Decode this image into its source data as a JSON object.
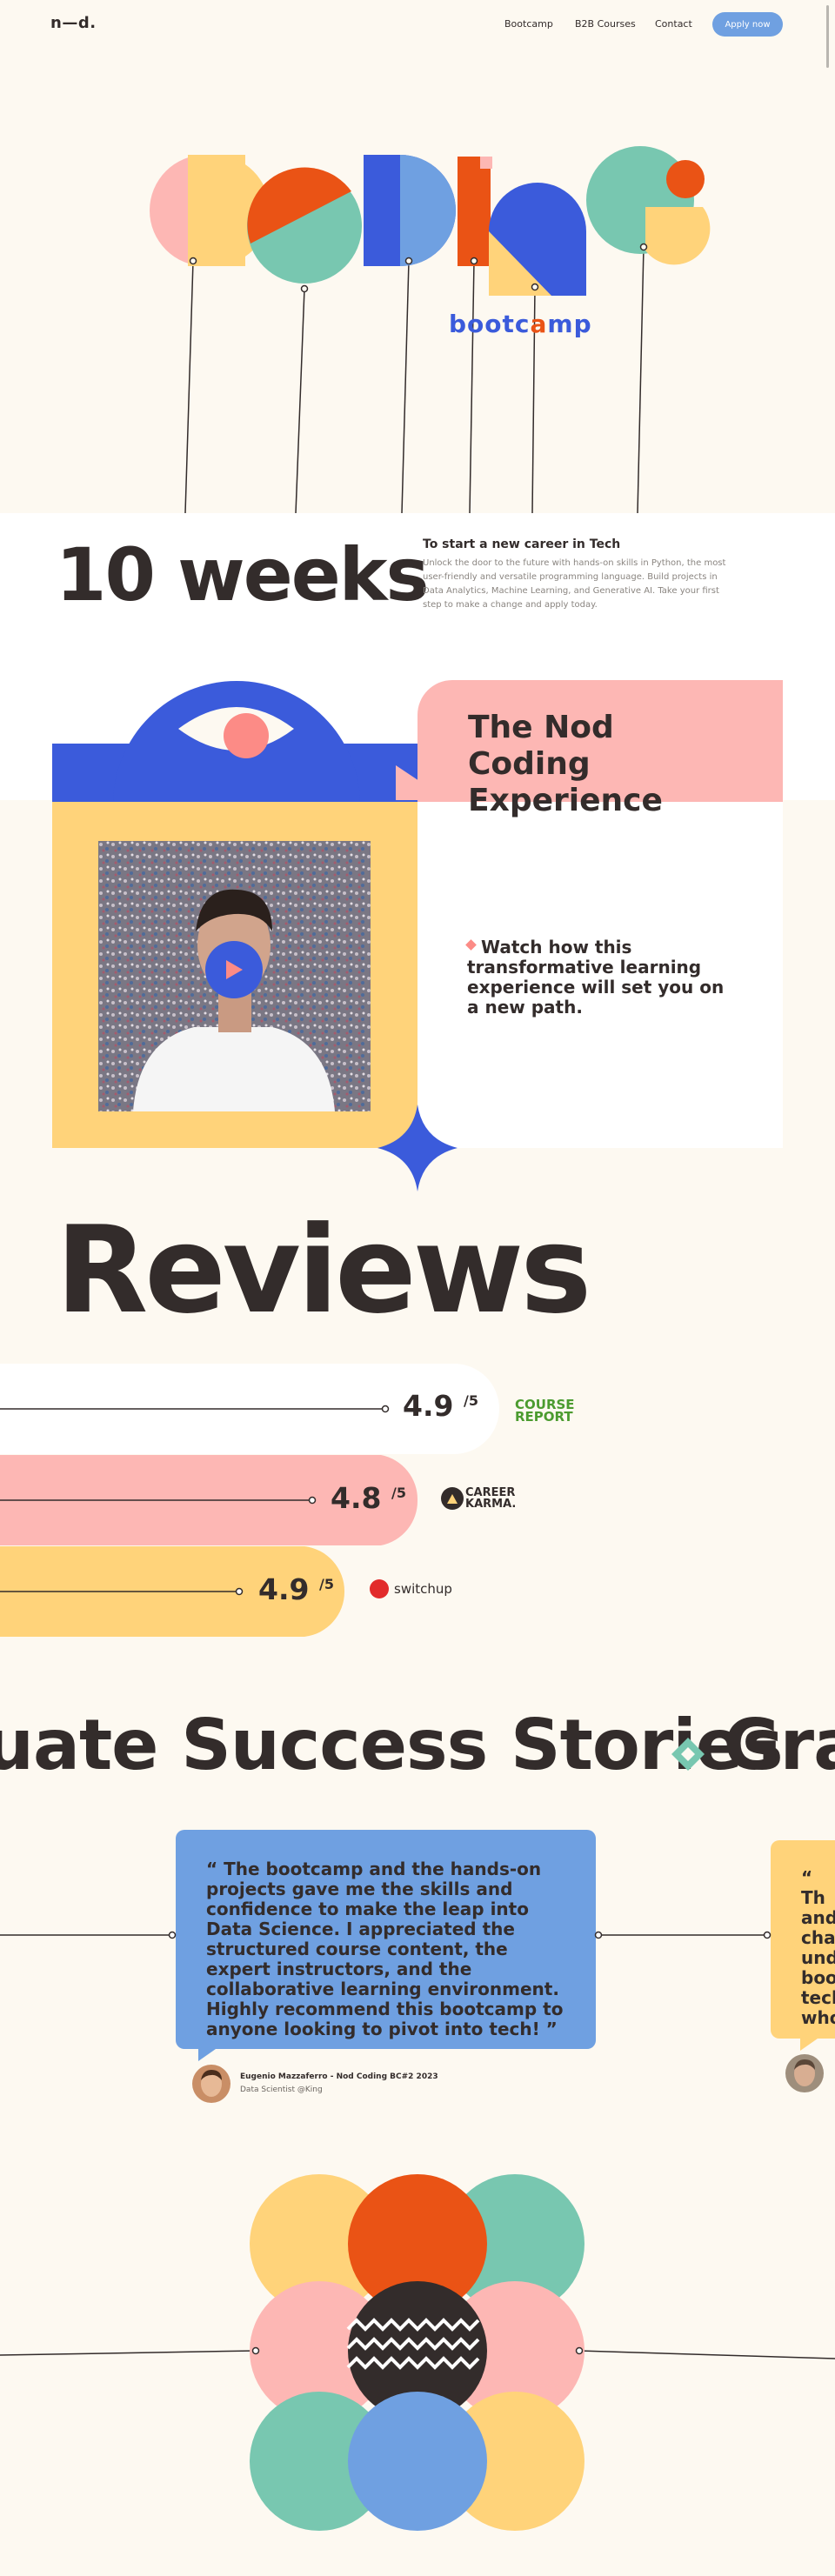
{
  "nav": {
    "logo": "n—d.",
    "links": [
      "Bootcamp",
      "B2B Courses",
      "Contact"
    ],
    "apply_label": "Apply now"
  },
  "hero": {
    "word_image_label": "Coding",
    "bootcamp_word": "b●●tc▲mp",
    "duration": "10 weeks",
    "career_title": "To start a new career in Tech",
    "career_text": "Unlock the door to the future with hands-on skills in Python, the most user-friendly and versatile programming language. Build projects in Data Analytics, Machine Learning, and Generative AI. Take your first step to make a change and apply today."
  },
  "experience": {
    "title": "The Nod Coding Experience",
    "watch_text": "Watch how this transformative learning experience will set you on a new path.",
    "play_icon": "play-icon"
  },
  "reviews": {
    "heading": "Reviews",
    "items": [
      {
        "score": "4.9",
        "suffix": "/5",
        "source": "COURSE REPORT",
        "color": "#ffffff"
      },
      {
        "score": "4.8",
        "suffix": "/5",
        "source": "CAREER KARMA.",
        "color": "#fdb7b4"
      },
      {
        "score": "4.9",
        "suffix": "/5",
        "source": "switchup",
        "color": "#ffd37a"
      }
    ]
  },
  "stories": {
    "marquee": "uate Success Stories",
    "marquee_next": "Gra",
    "quote_main": "“ The bootcamp and the hands-on projects gave me the skills and confidence to make the leap into Data Science. I appreciated the structured course content, the expert instructors, and the collaborative learning environment. Highly recommend this bootcamp to anyone looking to pivot into tech! ”",
    "quote_next": "“ Th and chal und boo tech who",
    "reviewer_name": "Eugenio Mazzaferro - Nod Coding BC#2 2023",
    "reviewer_role": "Data Scientist @King"
  },
  "colors": {
    "cream": "#fdf9f1",
    "blue": "#3b5bdb",
    "light_blue": "#6fa0e1",
    "orange": "#ea5315",
    "teal": "#78c7b0",
    "pink": "#fdb7b4",
    "yellow": "#ffd37a",
    "dark": "#332c2b"
  }
}
